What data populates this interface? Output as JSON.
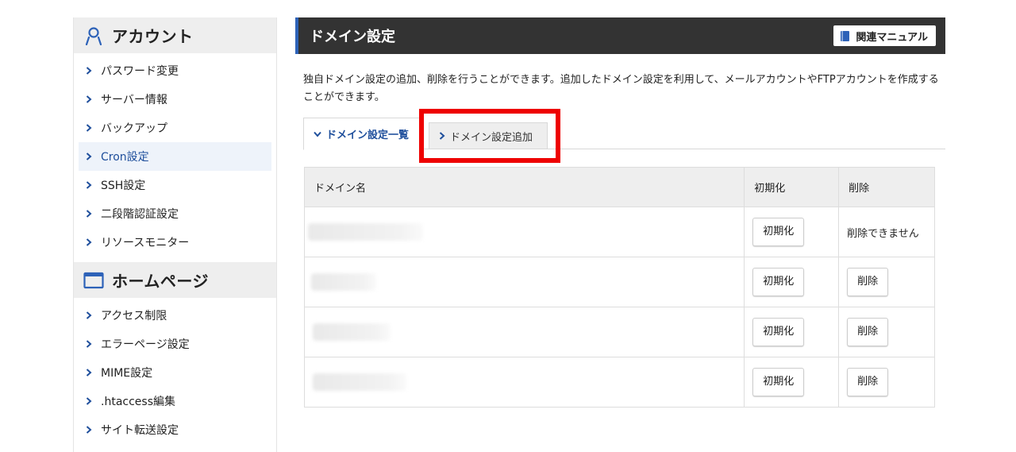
{
  "sidebar": {
    "account_section": {
      "title": "アカウント",
      "icon": "user-icon",
      "items": [
        {
          "label": "パスワード変更"
        },
        {
          "label": "サーバー情報"
        },
        {
          "label": "バックアップ"
        },
        {
          "label": "Cron設定",
          "active": true
        },
        {
          "label": "SSH設定"
        },
        {
          "label": "二段階認証設定"
        },
        {
          "label": "リソースモニター"
        }
      ]
    },
    "homepage_section": {
      "title": "ホームページ",
      "icon": "browser-window-icon",
      "items": [
        {
          "label": "アクセス制限"
        },
        {
          "label": "エラーページ設定"
        },
        {
          "label": "MIME設定"
        },
        {
          "label": ".htaccess編集"
        },
        {
          "label": "サイト転送設定"
        }
      ]
    }
  },
  "main": {
    "title": "ドメイン設定",
    "manual_button": "関連マニュアル",
    "description": "独自ドメイン設定の追加、削除を行うことができます。追加したドメイン設定を利用して、メールアカウントやFTPアカウントを作成することができます。",
    "tabs": [
      {
        "label": "ドメイン設定一覧",
        "active": true
      },
      {
        "label": "ドメイン設定追加",
        "active": false
      }
    ]
  },
  "table": {
    "headers": [
      "ドメイン名",
      "初期化",
      "削除"
    ],
    "rows": [
      {
        "domain": "",
        "init": "初期化",
        "delete": "削除できません",
        "deletable": false
      },
      {
        "domain": "",
        "init": "初期化",
        "delete": "削除",
        "deletable": true
      },
      {
        "domain": "",
        "init": "初期化",
        "delete": "削除",
        "deletable": true
      },
      {
        "domain": "",
        "init": "初期化",
        "delete": "削除",
        "deletable": true
      }
    ]
  },
  "colors": {
    "accent": "#1f4f9c",
    "title_bar": "#333333",
    "highlight": "#ee0000"
  }
}
